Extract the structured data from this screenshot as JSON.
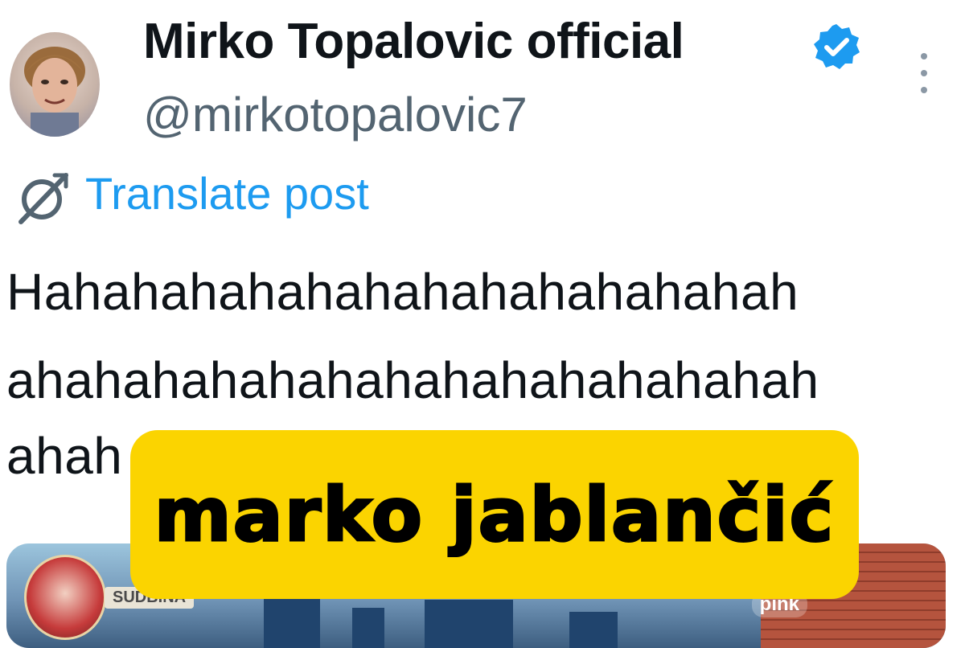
{
  "post": {
    "display_name": "Mirko Topalovic official",
    "handle": "@mirkotopalovic7",
    "translate_label": "Translate post",
    "text_lines": [
      "Hahahahahahahahahahahahahah",
      "ahahahahahahahahahahahahahah",
      "ahah"
    ]
  },
  "media": {
    "show_label": "SUDBINA",
    "channel_logo": "pink"
  },
  "overlay": {
    "caption": "marko jablančić",
    "background_color": "#fbd400"
  },
  "icons": {
    "verified": "verified-badge-icon",
    "translate": "globe-icon",
    "more": "more-vertical-icon"
  },
  "colors": {
    "text_primary": "#0f1419",
    "text_secondary": "#536471",
    "accent": "#1d9bf0"
  }
}
